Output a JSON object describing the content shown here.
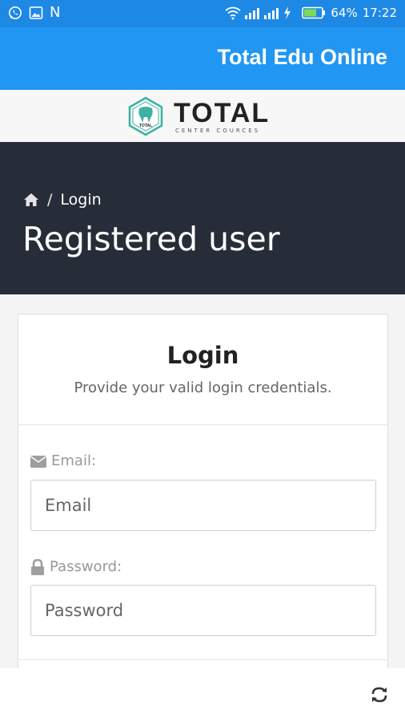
{
  "status_bar": {
    "left_icons": [
      "whatsapp-icon",
      "image-icon"
    ],
    "left_letter": "N",
    "battery": "64%",
    "time": "17:22"
  },
  "app_bar": {
    "title": "Total Edu Online"
  },
  "logo": {
    "main": "TOTAL",
    "sub": "CENTER COURCES",
    "badge": "TOTAL"
  },
  "hero": {
    "breadcrumb": {
      "home_icon": "home-icon",
      "separator": "/",
      "current": "Login"
    },
    "title": "Registered user"
  },
  "login_card": {
    "title": "Login",
    "subtitle": "Provide your valid login credentials.",
    "email": {
      "label": "Email:",
      "placeholder": "Email",
      "icon": "envelope-icon"
    },
    "password": {
      "label": "Password:",
      "placeholder": "Password",
      "icon": "lock-icon"
    }
  },
  "bottom_bar": {
    "refresh_icon": "refresh-icon"
  },
  "colors": {
    "status_bar": "#1e88e5",
    "app_bar": "#2196f3",
    "hero": "#272d38",
    "logo_teal": "#3fb1a3"
  }
}
